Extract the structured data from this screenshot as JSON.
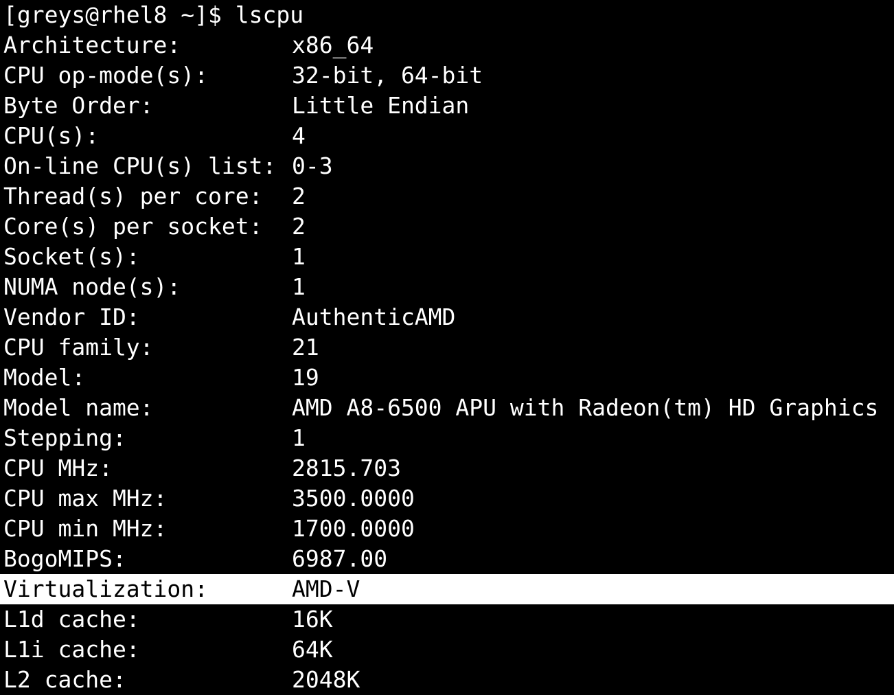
{
  "terminal": {
    "prompt": "[greys@rhel8 ~]$ lscpu",
    "rows": [
      {
        "key": "Architecture:",
        "value": "x86_64"
      },
      {
        "key": "CPU op-mode(s):",
        "value": "32-bit, 64-bit"
      },
      {
        "key": "Byte Order:",
        "value": "Little Endian"
      },
      {
        "key": "CPU(s):",
        "value": "4"
      },
      {
        "key": "On-line CPU(s) list:",
        "value": "0-3"
      },
      {
        "key": "Thread(s) per core:",
        "value": "2"
      },
      {
        "key": "Core(s) per socket:",
        "value": "2"
      },
      {
        "key": "Socket(s):",
        "value": "1"
      },
      {
        "key": "NUMA node(s):",
        "value": "1"
      },
      {
        "key": "Vendor ID:",
        "value": "AuthenticAMD"
      },
      {
        "key": "CPU family:",
        "value": "21"
      },
      {
        "key": "Model:",
        "value": "19"
      },
      {
        "key": "Model name:",
        "value": "AMD A8-6500 APU with Radeon(tm) HD Graphics"
      },
      {
        "key": "Stepping:",
        "value": "1"
      },
      {
        "key": "CPU MHz:",
        "value": "2815.703"
      },
      {
        "key": "CPU max MHz:",
        "value": "3500.0000"
      },
      {
        "key": "CPU min MHz:",
        "value": "1700.0000"
      },
      {
        "key": "BogoMIPS:",
        "value": "6987.00"
      },
      {
        "key": "Virtualization:",
        "value": "AMD-V"
      },
      {
        "key": "L1d cache:",
        "value": "16K"
      },
      {
        "key": "L1i cache:",
        "value": "64K"
      },
      {
        "key": "L2 cache:",
        "value": "2048K"
      }
    ],
    "highlighted_row_index": 18,
    "colors": {
      "background": "#000000",
      "foreground": "#ffffff",
      "highlight_background": "#ffffff",
      "highlight_foreground": "#000000"
    }
  }
}
